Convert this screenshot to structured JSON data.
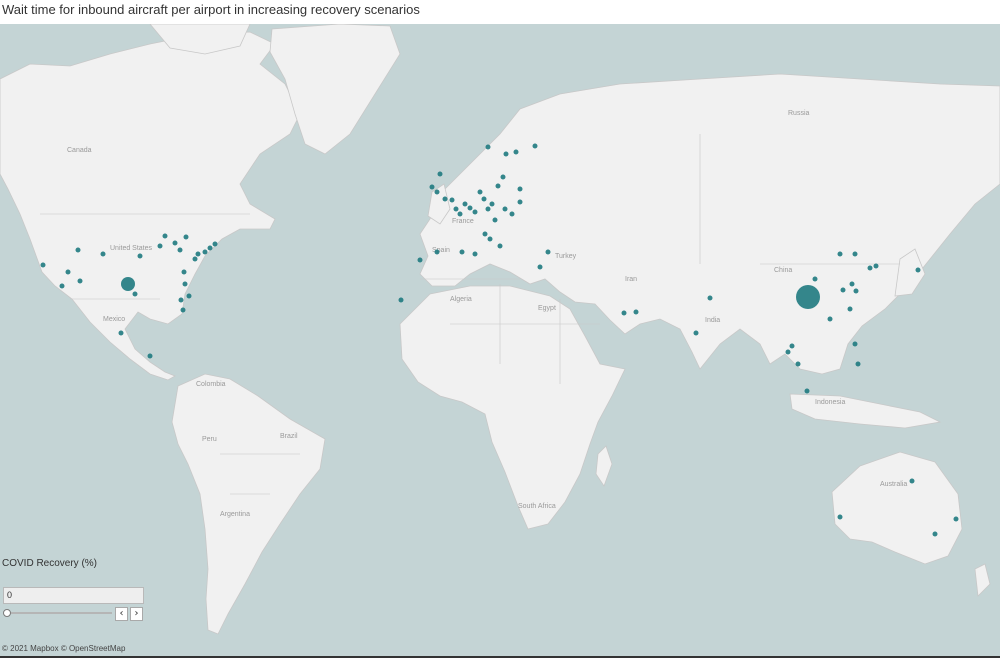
{
  "title": "Wait time for inbound aircraft per airport in increasing recovery scenarios",
  "map": {
    "ocean_color": "#c4d4d5",
    "land_color": "#f1f1f1",
    "border_color": "#c8c8c8",
    "marker_color": "#1f7a7f",
    "labels": [
      {
        "id": "canada",
        "text": "Canada"
      },
      {
        "id": "united-states",
        "text": "United States"
      },
      {
        "id": "mexico",
        "text": "Mexico"
      },
      {
        "id": "colombia",
        "text": "Colombia"
      },
      {
        "id": "peru",
        "text": "Peru"
      },
      {
        "id": "brazil",
        "text": "Brazil"
      },
      {
        "id": "argentina",
        "text": "Argentina"
      },
      {
        "id": "russia",
        "text": "Russia"
      },
      {
        "id": "china",
        "text": "China"
      },
      {
        "id": "india",
        "text": "India"
      },
      {
        "id": "iran",
        "text": "Iran"
      },
      {
        "id": "turkey",
        "text": "Turkey"
      },
      {
        "id": "algeria",
        "text": "Algeria"
      },
      {
        "id": "egypt",
        "text": "Egypt"
      },
      {
        "id": "south-africa",
        "text": "South Africa"
      },
      {
        "id": "australia",
        "text": "Australia"
      },
      {
        "id": "indonesia",
        "text": "Indonesia"
      },
      {
        "id": "france",
        "text": "France"
      },
      {
        "id": "spain",
        "text": "Spain"
      }
    ]
  },
  "control": {
    "title": "COVID Recovery (%)",
    "value": "0",
    "slider_position": 0,
    "prev_symbol": "‹",
    "next_symbol": "›"
  },
  "attribution": "© 2021 Mapbox © OpenStreetMap"
}
